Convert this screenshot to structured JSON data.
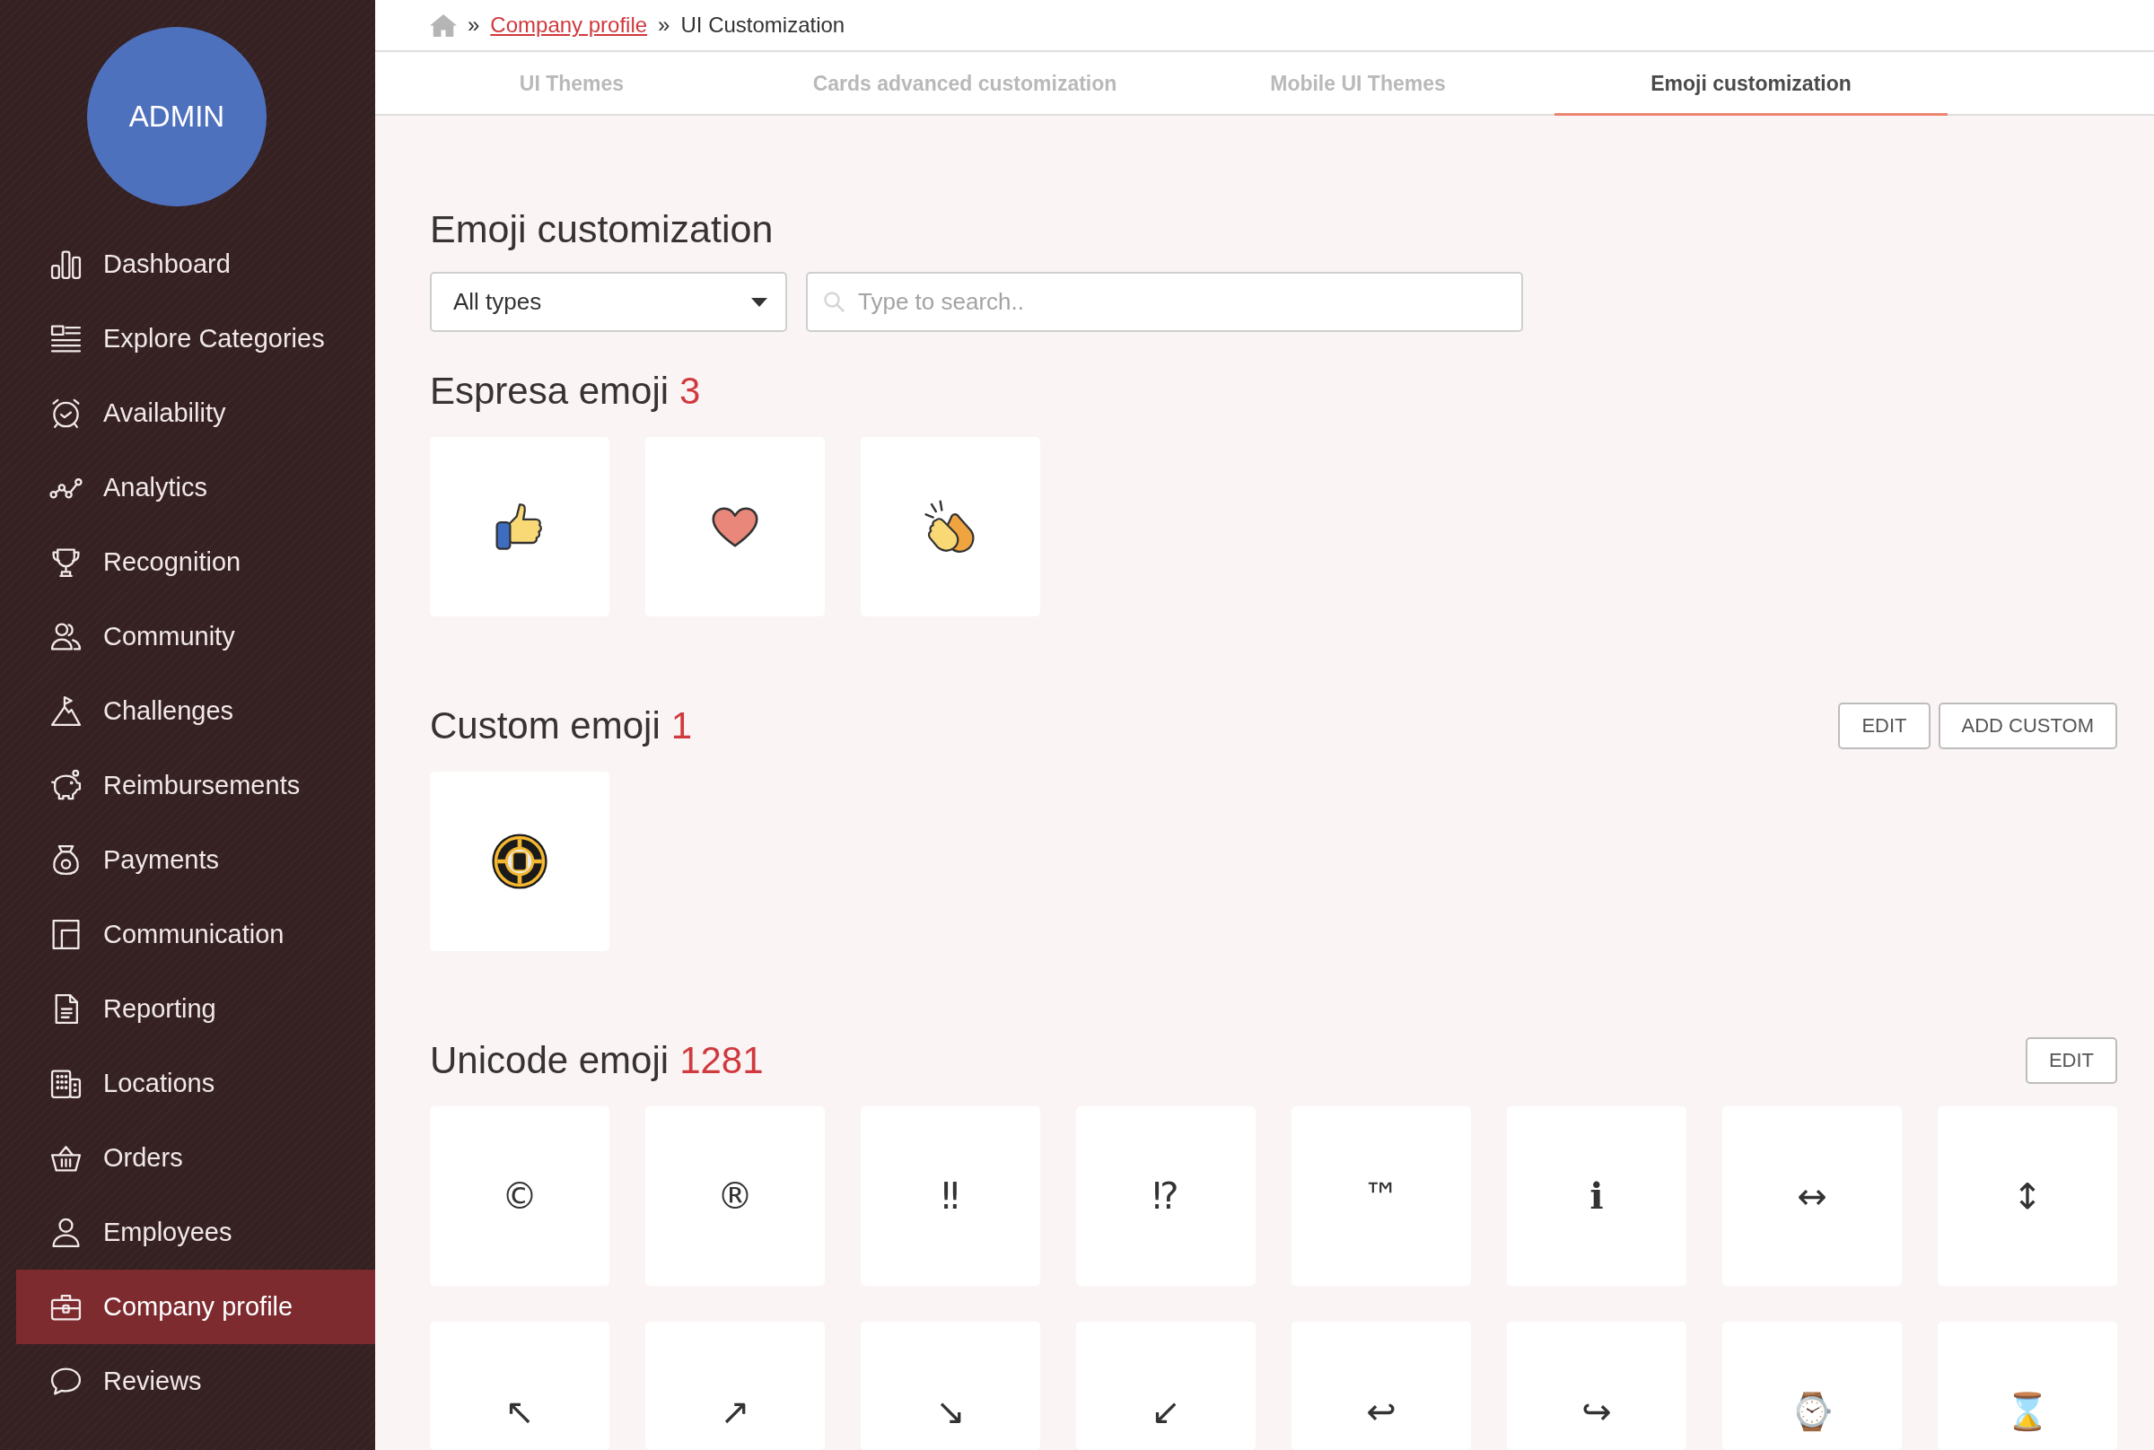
{
  "sidebar": {
    "avatar": "ADMIN",
    "items": [
      {
        "label": "Dashboard",
        "selected": false
      },
      {
        "label": "Explore Categories",
        "selected": false
      },
      {
        "label": "Availability",
        "selected": false
      },
      {
        "label": "Analytics",
        "selected": false
      },
      {
        "label": "Recognition",
        "selected": false
      },
      {
        "label": "Community",
        "selected": false
      },
      {
        "label": "Challenges",
        "selected": false
      },
      {
        "label": "Reimbursements",
        "selected": false
      },
      {
        "label": "Payments",
        "selected": false
      },
      {
        "label": "Communication",
        "selected": false
      },
      {
        "label": "Reporting",
        "selected": false
      },
      {
        "label": "Locations",
        "selected": false
      },
      {
        "label": "Orders",
        "selected": false
      },
      {
        "label": "Employees",
        "selected": false
      },
      {
        "label": "Company profile",
        "selected": true
      },
      {
        "label": "Reviews",
        "selected": false
      }
    ]
  },
  "breadcrumb": [
    {
      "kind": "home"
    },
    {
      "kind": "separator",
      "text": "»"
    },
    {
      "kind": "link",
      "text": "Company profile"
    },
    {
      "kind": "separator",
      "text": "»"
    },
    {
      "kind": "current",
      "text": "UI Customization"
    }
  ],
  "tabs": [
    {
      "label": "UI Themes",
      "selected": false
    },
    {
      "label": "Cards advanced customization",
      "selected": false
    },
    {
      "label": "Mobile UI Themes",
      "selected": false
    },
    {
      "label": "Emoji customization",
      "selected": true
    }
  ],
  "page_title": "Emoji customization",
  "filters": {
    "type": {
      "value": "All types"
    },
    "search": {
      "placeholder": "Type to search.."
    }
  },
  "sections": [
    {
      "title": "Espresa emoji",
      "count": "3",
      "emojis": [
        {
          "kind": "thumb"
        },
        {
          "kind": "heart"
        },
        {
          "kind": "clap"
        }
      ]
    },
    {
      "title": "Custom emoji",
      "count": "1",
      "buttons": [
        "EDIT",
        "ADD CUSTOM"
      ],
      "emojis": [
        {
          "kind": "emblem"
        }
      ]
    },
    {
      "title": "Unicode emoji",
      "count": "1281",
      "buttons": [
        "EDIT"
      ],
      "emojis": [
        {
          "kind": "glyph",
          "char": "©"
        },
        {
          "kind": "glyph",
          "char": "®"
        },
        {
          "kind": "glyph",
          "char": "‼"
        },
        {
          "kind": "glyph",
          "char": "⁉"
        },
        {
          "kind": "glyph",
          "char": "™"
        },
        {
          "kind": "glyph",
          "char": "ℹ"
        },
        {
          "kind": "glyph",
          "char": "↔"
        },
        {
          "kind": "glyph",
          "char": "↕"
        },
        {
          "kind": "glyph",
          "char": "↖"
        },
        {
          "kind": "glyph",
          "char": "↗"
        },
        {
          "kind": "glyph",
          "char": "↘"
        },
        {
          "kind": "glyph",
          "char": "↙"
        },
        {
          "kind": "glyph",
          "char": "↩"
        },
        {
          "kind": "glyph",
          "char": "↪"
        },
        {
          "kind": "glyph",
          "char": "⌚"
        },
        {
          "kind": "glyph",
          "char": "⌛"
        }
      ]
    }
  ]
}
